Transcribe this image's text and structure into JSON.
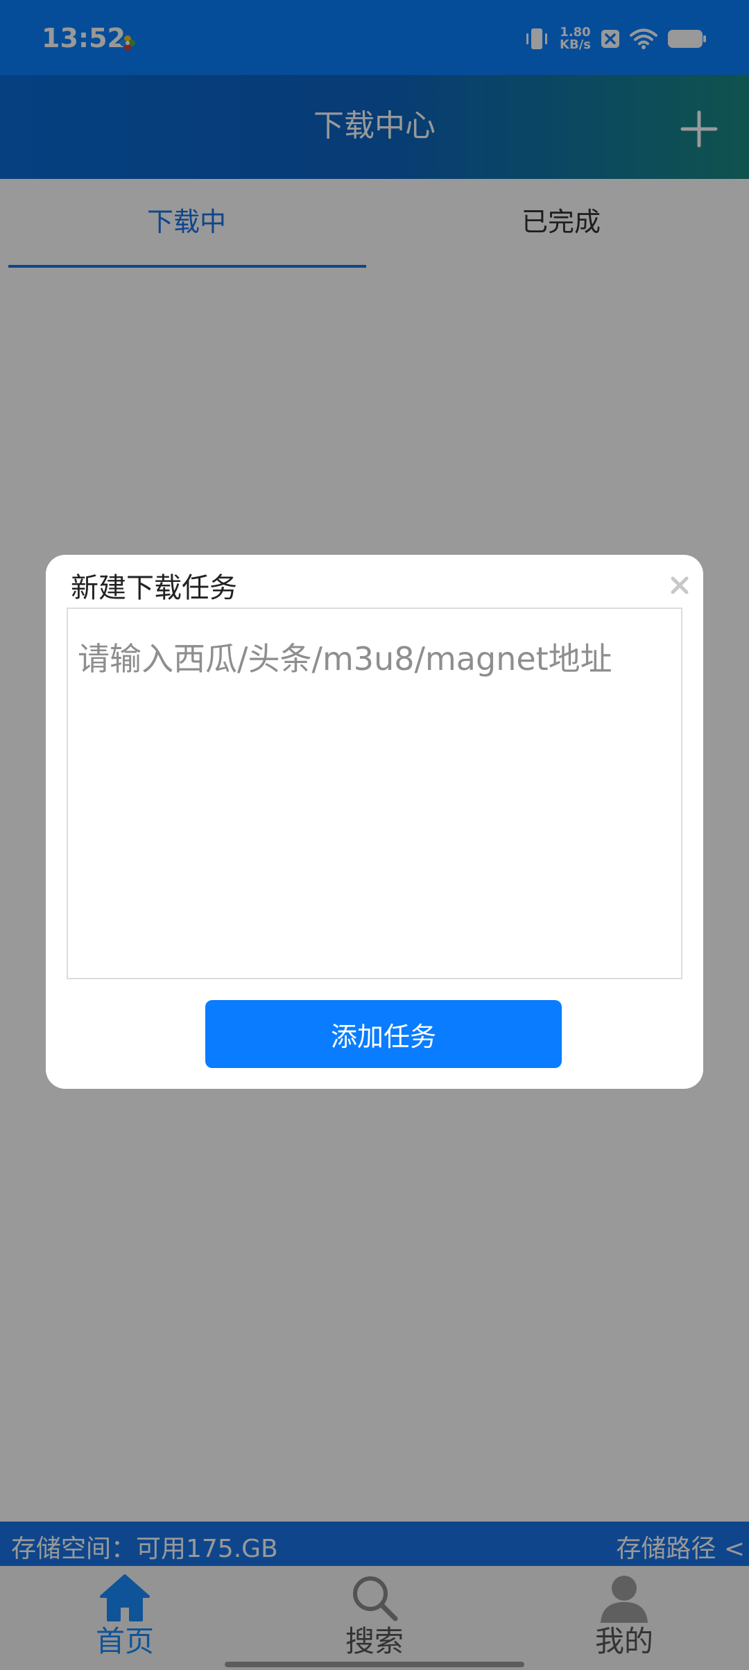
{
  "status_bar": {
    "time": "13:52",
    "net_speed_value": "1.80",
    "net_speed_unit": "KB/s"
  },
  "header": {
    "title": "下载中心"
  },
  "tabs": [
    {
      "label": "下载中"
    },
    {
      "label": "已完成"
    }
  ],
  "storage": {
    "available": "存储空间：可用175.GB",
    "path": "存储路径 <"
  },
  "bottom_nav": [
    {
      "label": "首页",
      "icon": "home-icon"
    },
    {
      "label": "搜索",
      "icon": "search-icon"
    },
    {
      "label": "我的",
      "icon": "user-icon"
    }
  ],
  "dialog": {
    "title": "新建下载任务",
    "input_placeholder": "请输入西瓜/头条/m3u8/magnet地址",
    "input_value": "",
    "add_button": "添加任务"
  },
  "colors": {
    "status_bar": "#0a80ff",
    "accent": "#1a73e8",
    "button": "#0a7cff"
  }
}
